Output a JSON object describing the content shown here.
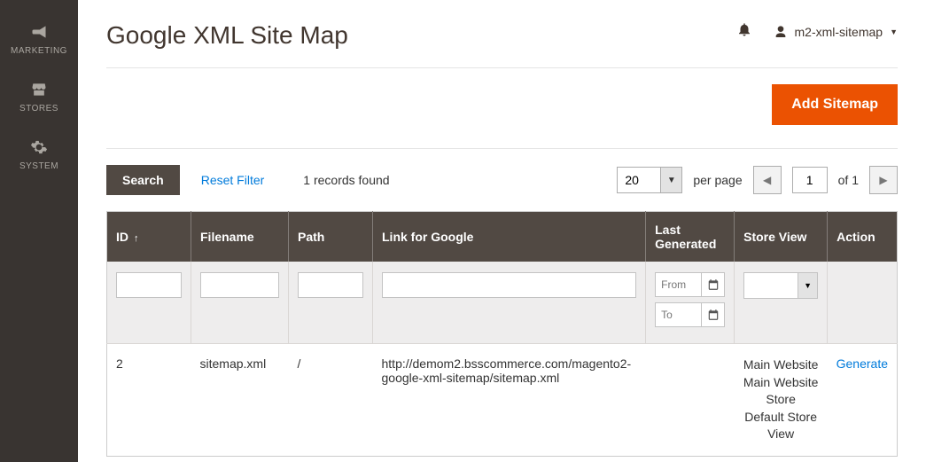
{
  "sidebar": {
    "items": [
      {
        "label": "MARKETING"
      },
      {
        "label": "STORES"
      },
      {
        "label": "SYSTEM"
      }
    ]
  },
  "header": {
    "title": "Google XML Site Map",
    "username": "m2-xml-sitemap"
  },
  "actions": {
    "add_label": "Add Sitemap"
  },
  "toolbar": {
    "search_label": "Search",
    "reset_label": "Reset Filter",
    "records": "1 records found",
    "page_size": "20",
    "per_page": "per page",
    "page_current": "1",
    "page_of": "of 1"
  },
  "columns": {
    "id": "ID",
    "filename": "Filename",
    "path": "Path",
    "link": "Link for Google",
    "last_gen": "Last Generated",
    "store": "Store View",
    "action": "Action"
  },
  "filters": {
    "from_ph": "From",
    "to_ph": "To"
  },
  "rows": [
    {
      "id": "2",
      "filename": "sitemap.xml",
      "path": "/",
      "link": "http://demom2.bsscommerce.com/magento2-google-xml-sitemap/sitemap.xml",
      "last_gen": "",
      "store": "Main Website\nMain Website Store\nDefault Store View",
      "action": "Generate"
    }
  ]
}
